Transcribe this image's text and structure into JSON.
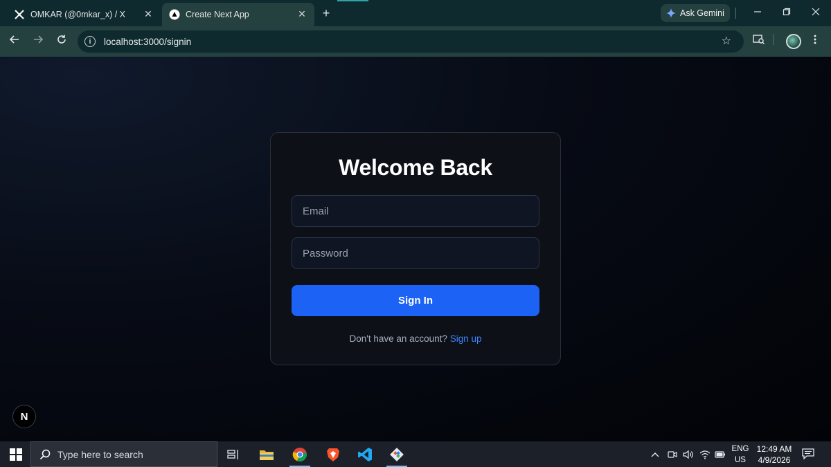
{
  "browser": {
    "tabs": [
      {
        "title": "OMKAR (@0mkar_x) / X",
        "icon": "x-logo-icon"
      },
      {
        "title": "Create Next App",
        "icon": "nextjs-triangle-icon"
      }
    ],
    "new_tab": "+",
    "ask_gemini": "Ask Gemini",
    "url": "localhost:3000/signin"
  },
  "page": {
    "title": "Welcome Back",
    "email_placeholder": "Email",
    "password_placeholder": "Password",
    "signin_label": "Sign In",
    "footer_text": "Don't have an account?",
    "signup_link": "Sign up",
    "next_badge": "N"
  },
  "taskbar": {
    "search_placeholder": "Type here to search",
    "lang_top": "ENG",
    "lang_bottom": "US",
    "time": "12:49 AM",
    "date": "4/9/2026"
  },
  "colors": {
    "primary_button": "#1b62f5",
    "link": "#3e86ff",
    "chrome_frame": "#0f2a2e",
    "chrome_toolbar": "#24403f"
  }
}
